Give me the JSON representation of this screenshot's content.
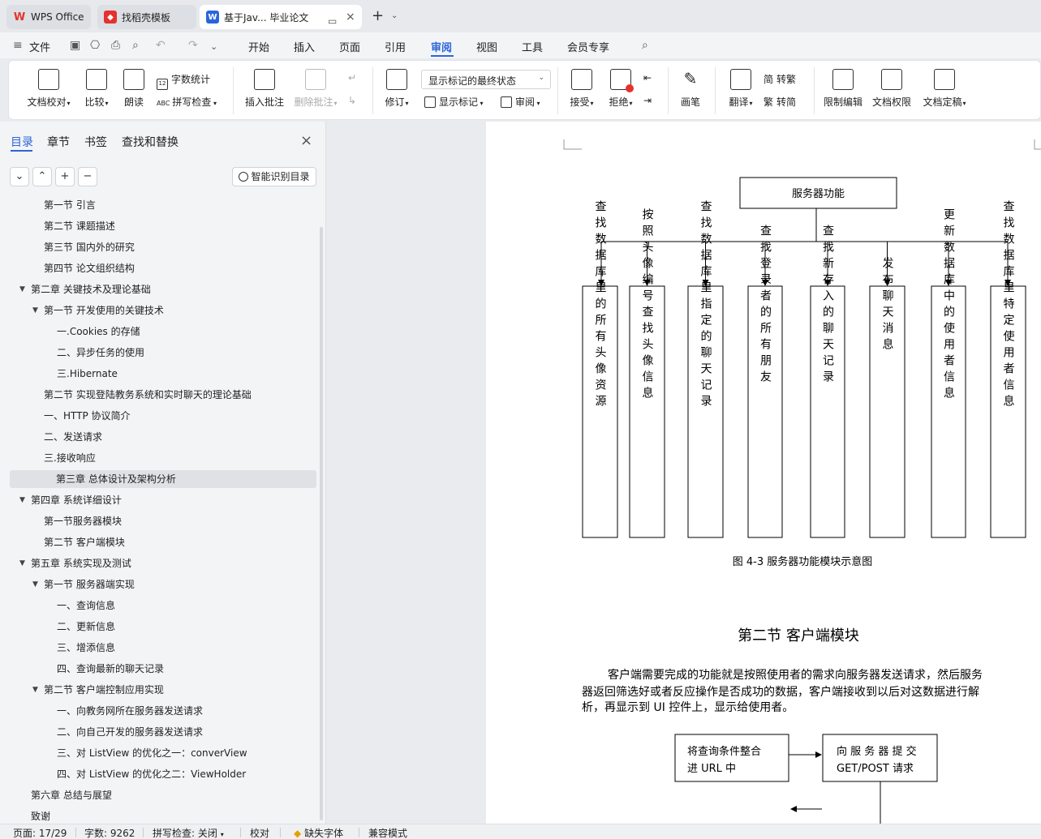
{
  "tabs": {
    "wps": "WPS Office",
    "template": "找稻壳模板",
    "doc": "基于Jav... 毕业论文"
  },
  "menu": {
    "file": "文件",
    "items": [
      "开始",
      "插入",
      "页面",
      "引用",
      "审阅",
      "视图",
      "工具",
      "会员专享"
    ],
    "active": "审阅"
  },
  "ribbon": {
    "proofread": "文档校对",
    "compare": "比较",
    "read_aloud": "朗读",
    "word_count": "字数统计",
    "spell_check": "拼写检查",
    "insert_comment": "插入批注",
    "delete_comment": "删除批注",
    "track_changes": "修订",
    "markup_select": "显示标记的最终状态",
    "show_markup": "显示标记",
    "review": "审阅",
    "accept": "接受",
    "reject": "拒绝",
    "pen": "画笔",
    "translate": "翻译",
    "to_traditional": "转繁",
    "to_simplified": "转简",
    "restrict_edit": "限制编辑",
    "doc_permission": "文档权限",
    "finalize": "文档定稿",
    "count_icon_text": "12",
    "spell_icon_text": "ABC",
    "fan_char": "简",
    "jian_char": "繁"
  },
  "panel": {
    "tabs": [
      "目录",
      "章节",
      "书签",
      "查找和替换"
    ],
    "smart_toc": "智能识别目录",
    "buttons": [
      "⌄",
      "⌃",
      "+",
      "−"
    ],
    "toc": [
      {
        "label": "第一节   引言",
        "level": 2,
        "arrow": ""
      },
      {
        "label": "第二节  课题描述",
        "level": 2,
        "arrow": ""
      },
      {
        "label": "第三节  国内外的研究",
        "level": 2,
        "arrow": ""
      },
      {
        "label": "第四节  论文组织结构",
        "level": 2,
        "arrow": ""
      },
      {
        "label": "第二章  关键技术及理论基础",
        "level": 1,
        "arrow": "▼"
      },
      {
        "label": "第一节  开发使用的关键技术",
        "level": 2,
        "arrow": "▼"
      },
      {
        "label": "一.Cookies 的存储",
        "level": 3,
        "arrow": ""
      },
      {
        "label": "二、异步任务的使用",
        "level": 3,
        "arrow": ""
      },
      {
        "label": "三.Hibernate",
        "level": 3,
        "arrow": ""
      },
      {
        "label": "第二节  实现登陆教务系统和实时聊天的理论基础",
        "level": 2,
        "arrow": ""
      },
      {
        "label": "一、HTTP 协议简介",
        "level": 2,
        "arrow": ""
      },
      {
        "label": "二、发送请求",
        "level": 2,
        "arrow": ""
      },
      {
        "label": "三.接收响应",
        "level": 2,
        "arrow": ""
      },
      {
        "label": "第三章  总体设计及架构分析",
        "level": 3,
        "arrow": "",
        "selected": true
      },
      {
        "label": "第四章  系统详细设计",
        "level": 1,
        "arrow": "▼"
      },
      {
        "label": "第一节服务器模块",
        "level": 2,
        "arrow": ""
      },
      {
        "label": "第二节  客户端模块",
        "level": 2,
        "arrow": ""
      },
      {
        "label": "第五章  系统实现及测试",
        "level": 1,
        "arrow": "▼"
      },
      {
        "label": "第一节  服务器端实现",
        "level": 2,
        "arrow": "▼"
      },
      {
        "label": "一、查询信息",
        "level": 3,
        "arrow": ""
      },
      {
        "label": "二、更新信息",
        "level": 3,
        "arrow": ""
      },
      {
        "label": "三、增添信息",
        "level": 3,
        "arrow": ""
      },
      {
        "label": "四、查询最新的聊天记录",
        "level": 3,
        "arrow": ""
      },
      {
        "label": "第二节  客户端控制应用实现",
        "level": 2,
        "arrow": "▼"
      },
      {
        "label": "一、向教务网所在服务器发送请求",
        "level": 3,
        "arrow": ""
      },
      {
        "label": "二、向自己开发的服务器发送请求",
        "level": 3,
        "arrow": ""
      },
      {
        "label": "三、对 ListView 的优化之一：converView",
        "level": 3,
        "arrow": ""
      },
      {
        "label": "四、对 ListView 的优化之二：ViewHolder",
        "level": 3,
        "arrow": ""
      },
      {
        "label": "第六章  总结与展望",
        "level": 1,
        "arrow": ""
      },
      {
        "label": "致谢",
        "level": 1,
        "arrow": ""
      }
    ]
  },
  "document": {
    "diagram_root": "服务器功能",
    "diagram_boxes": [
      "查找数据库里的所有头像资源",
      "按照头像编号查找头像信息",
      "查找数据库里指定的聊天记录",
      "查找登录者的所有朋友",
      "查找新存入的聊天记录",
      "发布聊天消息",
      "更新数据库中的使用者信息",
      "查找数据库里特定使用者信息"
    ],
    "figure_caption": "图 4-3  服务器功能模块示意图",
    "section_title": "第二节      客户端模块",
    "paragraph_lines": [
      "客户端需要完成的功能就是按照使用者的需求向服务器发送请求，然后服务",
      "器返回筛选好或者反应操作是否成功的数据，客户端接收到以后对这数据进行解",
      "析，再显示到 UI 控件上，显示给使用者。"
    ],
    "flow_box1": [
      "将查询条件整合",
      "进 URL 中"
    ],
    "flow_box2": [
      "向 服 务 器 提 交",
      "GET/POST 请求"
    ]
  },
  "status": {
    "page": "页面: 17/29",
    "words": "字数: 9262",
    "spell": "拼写检查: 关闭",
    "proof": "校对",
    "missing_font": "缺失字体",
    "compat": "兼容模式"
  },
  "colors": {
    "accent": "#2b66d9",
    "wps_red": "#e5322d"
  }
}
